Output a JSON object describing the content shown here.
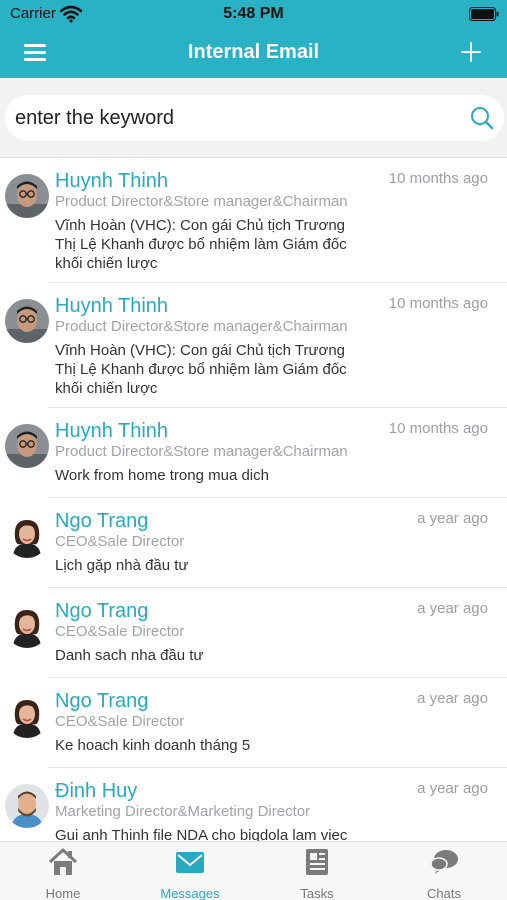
{
  "status_bar": {
    "carrier": "Carrier",
    "time": "5:48 PM"
  },
  "nav": {
    "title": "Internal Email",
    "menu_icon": "hamburger-menu-icon",
    "add_icon": "plus-icon"
  },
  "search": {
    "placeholder": "enter the keyword",
    "icon": "search-icon"
  },
  "messages": [
    {
      "sender": "Huynh Thinh",
      "role": "Product Director&Store manager&Chairman",
      "time": "10 months ago",
      "preview": "Vĩnh Hoàn (VHC): Con gái Chủ tịch Trương Thị Lệ Khanh được bổ nhiệm làm Giám đốc khối chiến lược",
      "avatar": "man-glasses"
    },
    {
      "sender": "Huynh Thinh",
      "role": "Product Director&Store manager&Chairman",
      "time": "10 months ago",
      "preview": "Vĩnh Hoàn (VHC): Con gái Chủ tịch Trương Thị Lệ Khanh được bổ nhiệm làm Giám đốc khối chiến lược",
      "avatar": "man-glasses"
    },
    {
      "sender": "Huynh Thinh",
      "role": "Product Director&Store manager&Chairman",
      "time": "10 months ago",
      "preview": "Work from home trong mua dich",
      "avatar": "man-glasses"
    },
    {
      "sender": "Ngo Trang",
      "role": "CEO&Sale Director",
      "time": "a year ago",
      "preview": "Lịch gặp nhà đầu tư",
      "avatar": "woman"
    },
    {
      "sender": "Ngo Trang",
      "role": "CEO&Sale Director",
      "time": "a year ago",
      "preview": "Danh sach nha đầu tư",
      "avatar": "woman"
    },
    {
      "sender": "Ngo Trang",
      "role": "CEO&Sale Director",
      "time": "a year ago",
      "preview": "Ke hoach kinh doanh tháng 5",
      "avatar": "woman"
    },
    {
      "sender": "Đinh Huy",
      "role": "Marketing Director&Marketing Director",
      "time": "a year ago",
      "preview": "Gui anh Thinh file NDA cho bigdola lam viec voi",
      "avatar": "man-beard"
    }
  ],
  "tabs": [
    {
      "label": "Home",
      "icon": "home-icon",
      "active": false
    },
    {
      "label": "Messages",
      "icon": "envelope-icon",
      "active": true
    },
    {
      "label": "Tasks",
      "icon": "newspaper-icon",
      "active": false
    },
    {
      "label": "Chats",
      "icon": "chat-bubbles-icon",
      "active": false
    }
  ],
  "colors": {
    "primary": "#29b2c6",
    "accent_text": "#29a9bf",
    "muted": "#9aa0a4"
  }
}
